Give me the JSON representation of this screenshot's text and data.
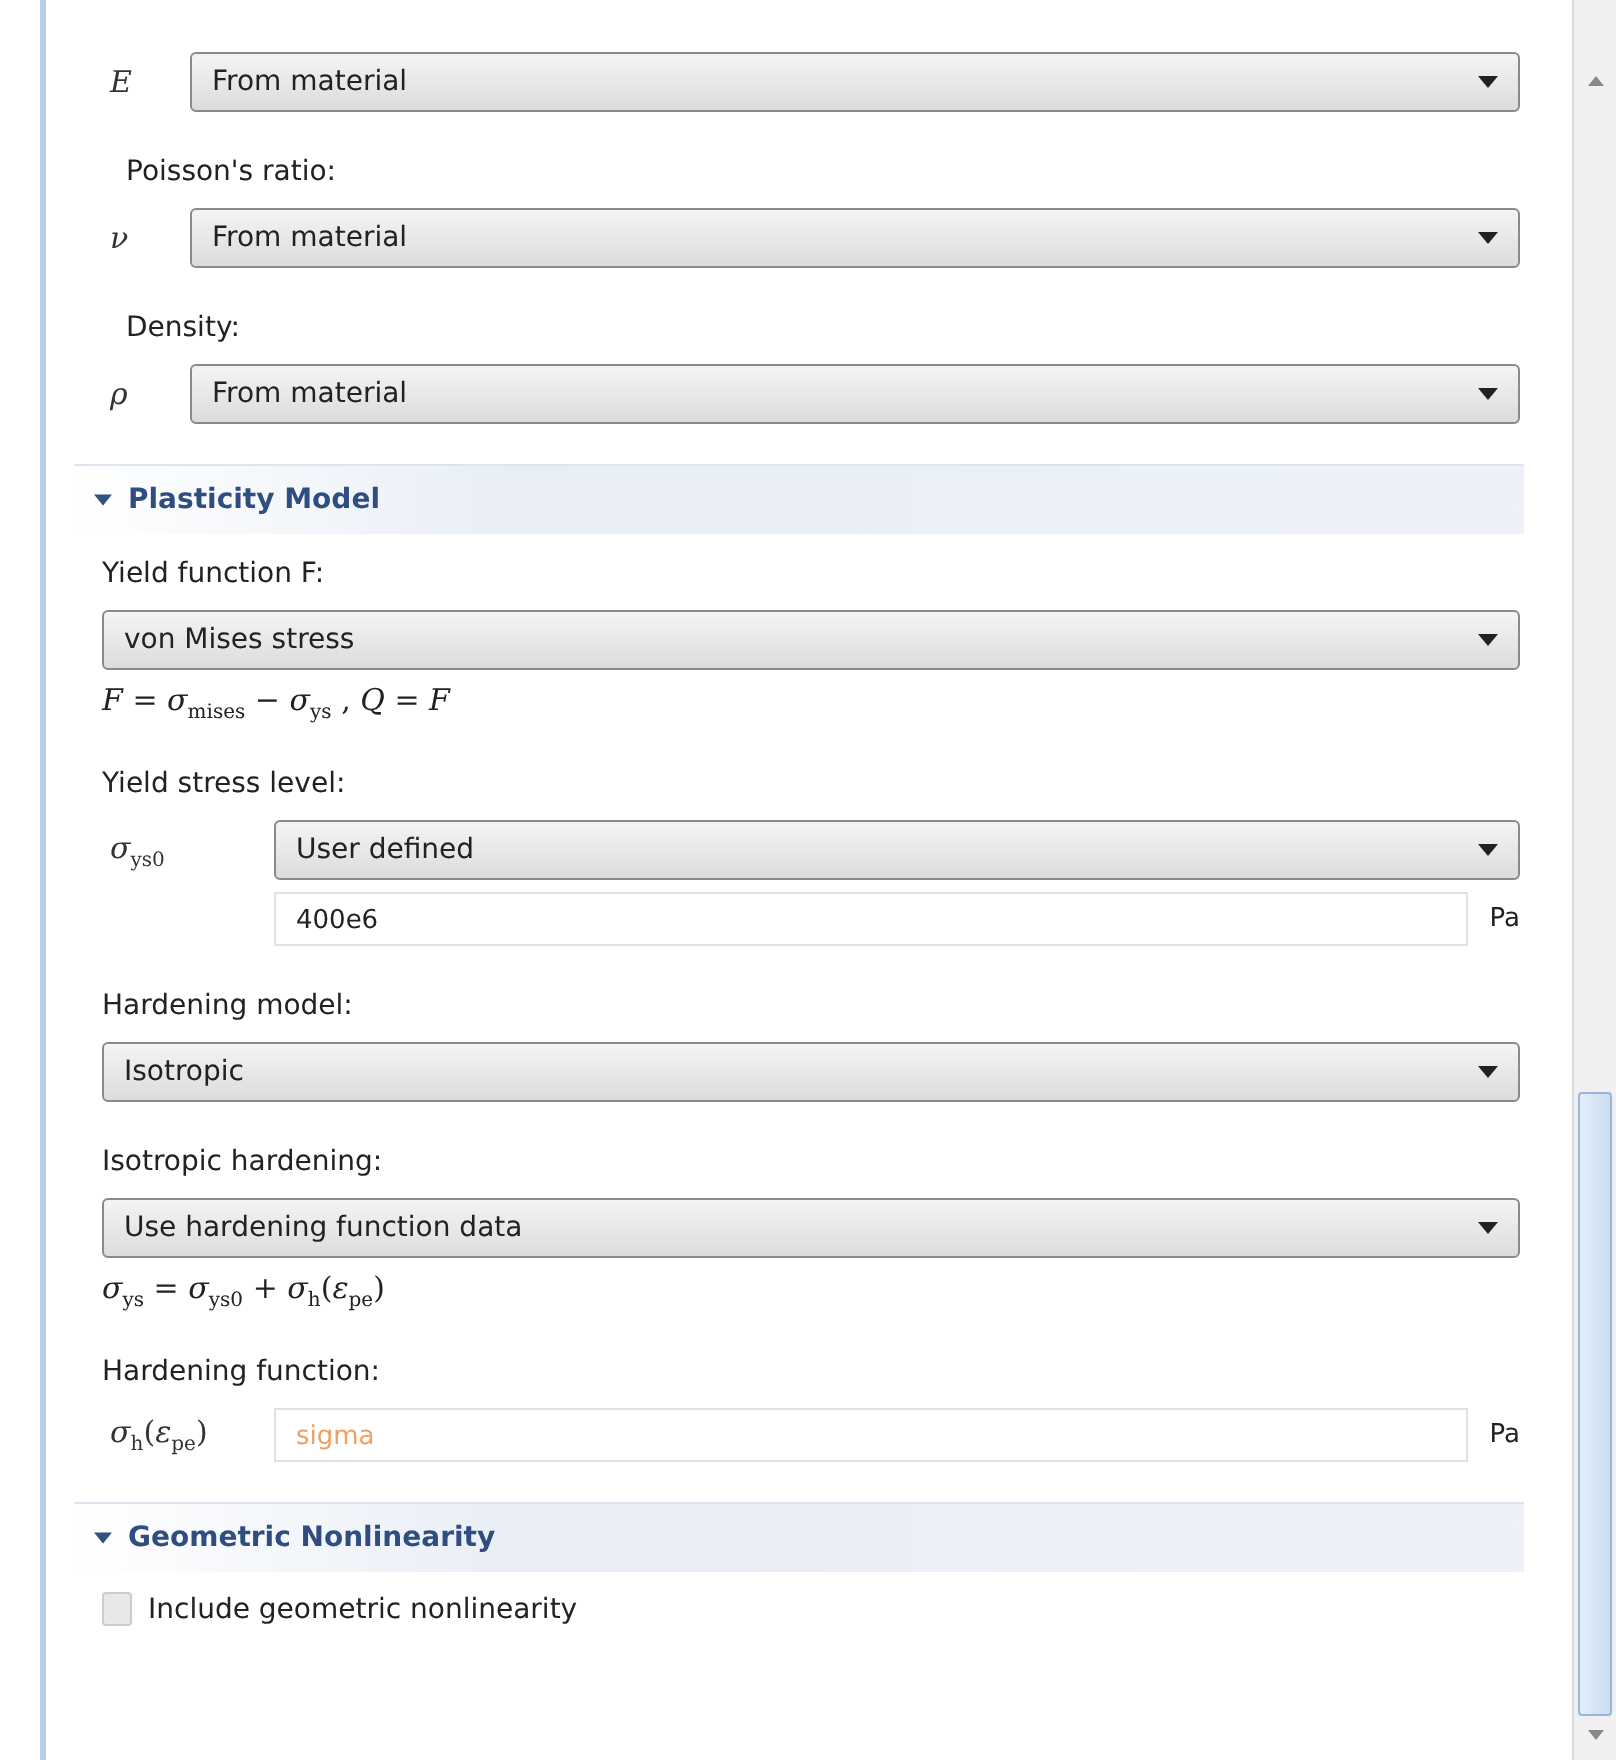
{
  "sections": [
    {
      "items": [
        {
          "kind": "dropdown",
          "symbol": "*E*",
          "value": "From material"
        },
        {
          "kind": "label",
          "text": "Poisson's ratio:"
        },
        {
          "kind": "dropdown",
          "symbol": "*ν*",
          "value": "From material"
        },
        {
          "kind": "label",
          "text": "Density:"
        },
        {
          "kind": "dropdown",
          "symbol": "*ρ*",
          "value": "From material"
        }
      ]
    },
    {
      "title": "Plasticity Model",
      "expanded": true,
      "items": [
        {
          "kind": "label",
          "text": "Yield function F:"
        },
        {
          "kind": "dropdown",
          "value": "von Mises stress"
        },
        {
          "kind": "equation",
          "text": "*F* = *σ*$_{mises}$ − *σ*$_{ys}$ ,   *Q* = *F*"
        },
        {
          "kind": "label",
          "text": "Yield stress level:"
        },
        {
          "kind": "dropdown",
          "symbol": "*σ*$_{ys0}$",
          "value": "User defined"
        },
        {
          "kind": "input",
          "value": "400e6",
          "unit": "Pa",
          "warning": false
        },
        {
          "kind": "label",
          "text": "Hardening model:"
        },
        {
          "kind": "dropdown",
          "value": "Isotropic"
        },
        {
          "kind": "label",
          "text": "Isotropic hardening:"
        },
        {
          "kind": "dropdown",
          "value": "Use hardening function data"
        },
        {
          "kind": "equation",
          "text": "*σ*$_{ys}$ = *σ*$_{ys0}$ + *σ*$_{h}$(*ε*$_{pe}$)"
        },
        {
          "kind": "label",
          "text": "Hardening function:"
        },
        {
          "kind": "input",
          "symbol": "*σ*$_{h}$(*ε*$_{pe}$)",
          "value": "sigma",
          "unit": "Pa",
          "warning": true
        }
      ]
    },
    {
      "title": "Geometric Nonlinearity",
      "expanded": true,
      "items": [
        {
          "kind": "checkbox",
          "text": "Include geometric nonlinearity",
          "checked": false
        }
      ]
    }
  ]
}
